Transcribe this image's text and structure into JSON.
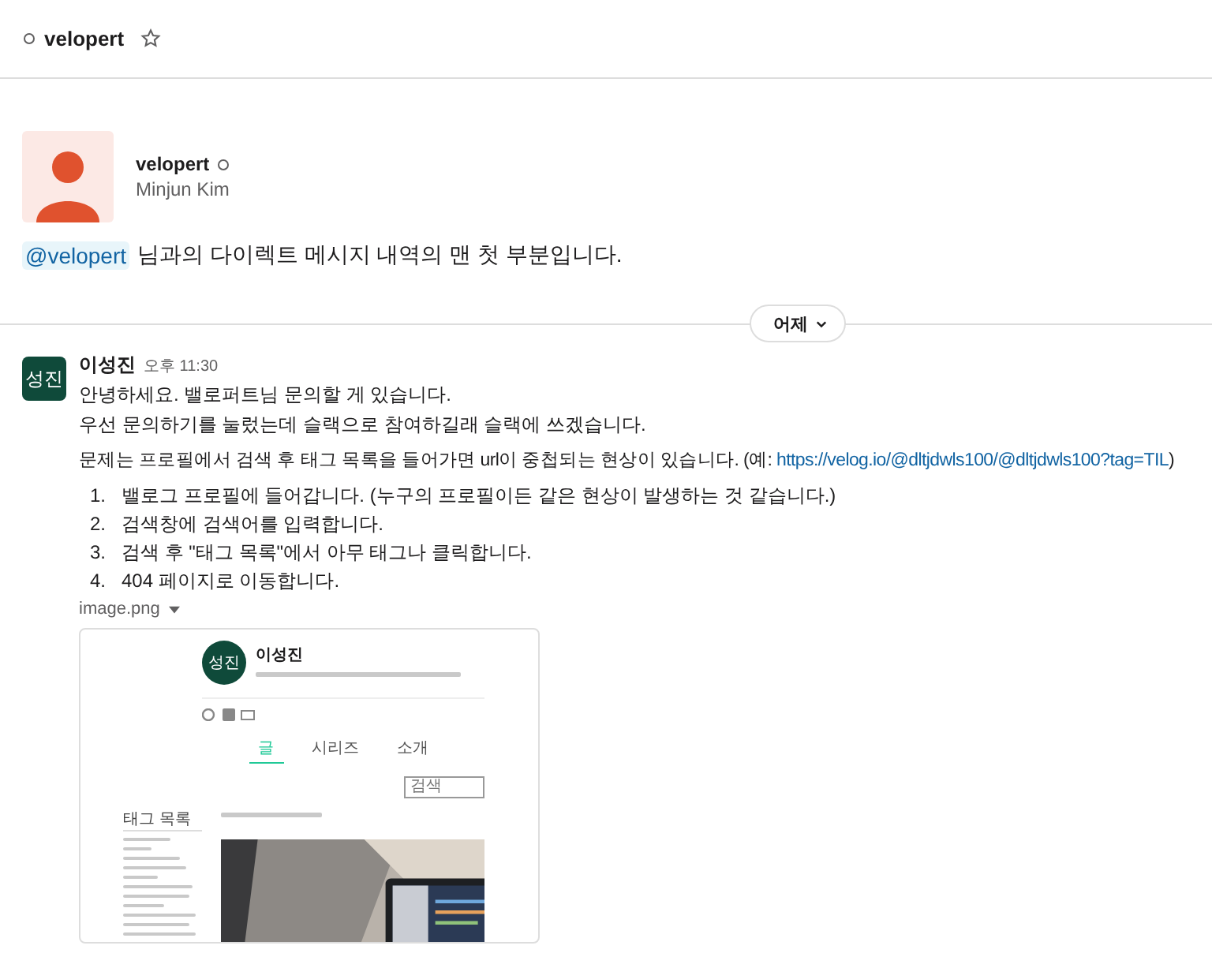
{
  "channel": {
    "name": "velopert",
    "active": false,
    "starred": false
  },
  "intro": {
    "display_name": "velopert",
    "active": false,
    "real_name": "Minjun Kim",
    "mention": "@velopert",
    "text": "님과의 다이렉트 메시지 내역의 맨 첫 부분입니다."
  },
  "day_divider": {
    "label": "어제"
  },
  "message": {
    "avatar_text": "성진",
    "author": "이성진",
    "time": "오후 11:30",
    "lines": [
      "안녕하세요. 밸로퍼트님 문의할 게 있습니다.",
      "우선 문의하기를 눌렀는데 슬랙으로 참여하길래 슬랙에 쓰겠습니다."
    ],
    "problem_text": "문제는 프로필에서 검색 후 태그 목록을 들어가면 url이 중첩되는 현상이 있습니다. (예: ",
    "link": "https://velog.io/@dltjdwls100/@dltjdwls100?tag=TIL",
    "problem_end": ")",
    "steps": [
      {
        "number": "1.",
        "text": "밸로그 프로필에 들어갑니다. (누구의 프로필이든 같은 현상이 발생하는 것 같습니다.)"
      },
      {
        "number": "2.",
        "text": "검색창에 검색어를 입력합니다."
      },
      {
        "number": "3.",
        "text": "검색 후 \"태그 목록\"에서 아무 태그나 클릭합니다."
      },
      {
        "number": "4.",
        "text": "404 페이지로 이동합니다."
      }
    ],
    "attachment": {
      "file_name": "image.png",
      "preview": {
        "avatar_text": "성진",
        "name": "이성진",
        "tabs": [
          {
            "label": "글",
            "selected": true
          },
          {
            "label": "시리즈",
            "selected": false
          },
          {
            "label": "소개",
            "selected": false
          }
        ],
        "search_placeholder": "검색",
        "sidebar_title": "태그 목록"
      }
    }
  }
}
